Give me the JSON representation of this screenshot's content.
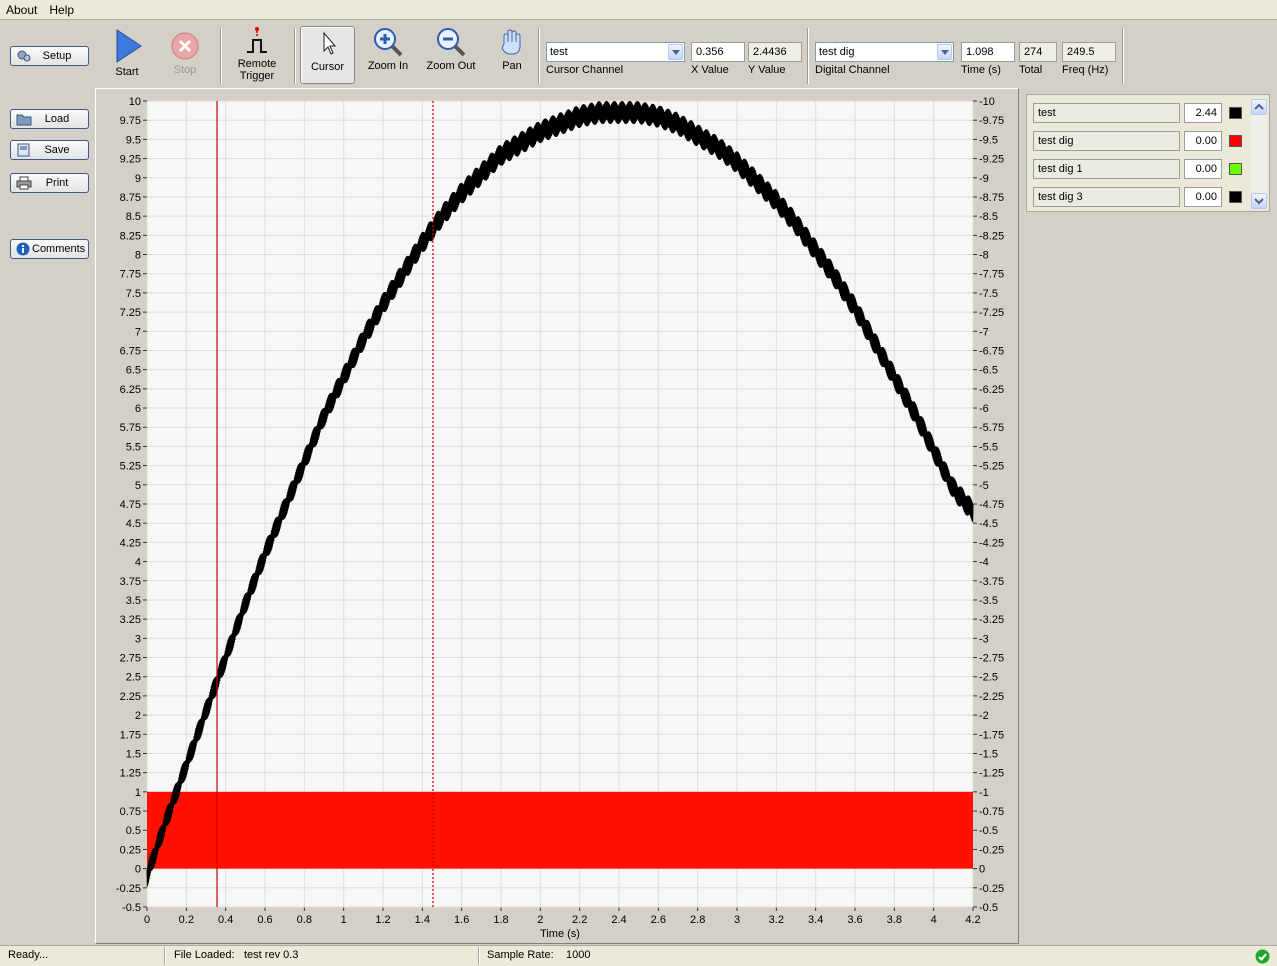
{
  "menu": [
    "About",
    "Help"
  ],
  "left_buttons": {
    "setup": "Setup",
    "load": "Load",
    "save": "Save",
    "print": "Print",
    "comments": "Comments"
  },
  "toolbar": {
    "start": "Start",
    "stop": "Stop",
    "remote_trigger_l1": "Remote",
    "remote_trigger_l2": "Trigger",
    "cursor": "Cursor",
    "zoom_in": "Zoom In",
    "zoom_out": "Zoom Out",
    "pan": "Pan",
    "cursor_channel": {
      "value": "test",
      "label": "Cursor Channel"
    },
    "x_value": {
      "value": "0.356",
      "label": "X Value"
    },
    "y_value": {
      "value": "2.4436",
      "label": "Y Value"
    },
    "digital_channel": {
      "value": "test dig",
      "label": "Digital Channel"
    },
    "time": {
      "value": "1.098",
      "label": "Time (s)"
    },
    "total": {
      "value": "274",
      "label": "Total"
    },
    "freq": {
      "value": "249.5",
      "label": "Freq (Hz)"
    }
  },
  "legend": [
    {
      "name": "test",
      "value": "2.44",
      "color": "#000000"
    },
    {
      "name": "test dig",
      "value": "0.00",
      "color": "#ff0000"
    },
    {
      "name": "test dig 1",
      "value": "0.00",
      "color": "#66ff00"
    },
    {
      "name": "test dig 3",
      "value": "0.00",
      "color": "#000000"
    }
  ],
  "chart_data": {
    "type": "line",
    "xlabel": "Time (s)",
    "ylabel": "",
    "xlim": [
      0,
      4.2
    ],
    "ylim": [
      -0.5,
      10
    ],
    "x_ticks": [
      "0",
      "0.2",
      "0.4",
      "0.6",
      "0.8",
      "1",
      "1.2",
      "1.4",
      "1.6",
      "1.8",
      "2",
      "2.2",
      "2.4",
      "2.6",
      "2.8",
      "3",
      "3.2",
      "3.4",
      "3.6",
      "3.8",
      "4",
      "4.2"
    ],
    "y_ticks": [
      "-0.5",
      "-0.25",
      "0",
      "0.25",
      "0.5",
      "0.75",
      "1",
      "1.25",
      "1.5",
      "1.75",
      "2",
      "2.25",
      "2.5",
      "2.75",
      "3",
      "3.25",
      "3.5",
      "3.75",
      "4",
      "4.25",
      "4.5",
      "4.75",
      "5",
      "5.25",
      "5.5",
      "5.75",
      "6",
      "6.25",
      "6.5",
      "6.75",
      "7",
      "7.25",
      "7.5",
      "7.75",
      "8",
      "8.25",
      "8.5",
      "8.75",
      "9",
      "9.25",
      "9.5",
      "9.75",
      "10"
    ],
    "y_ticks_right": [
      "-0.5",
      "-0.25",
      "0",
      "-0.25",
      "-0.5",
      "-0.75",
      "-1",
      "-1.25",
      "-1.5",
      "-1.75",
      "-2",
      "-2.25",
      "-2.5",
      "-2.75",
      "-3",
      "-3.25",
      "-3.5",
      "-3.75",
      "-4",
      "-4.25",
      "-4.5",
      "-4.75",
      "-5",
      "-5.25",
      "-5.5",
      "-5.75",
      "-6",
      "-6.25",
      "-6.5",
      "-6.75",
      "-7",
      "-7.25",
      "-7.5",
      "-7.75",
      "-8",
      "-8.25",
      "-8.5",
      "-8.75",
      "-9",
      "-9.25",
      "-9.5",
      "-9.75",
      "-10"
    ],
    "grid": true,
    "series": [
      {
        "name": "test",
        "color": "#000000",
        "x": [
          0,
          0.1,
          0.2,
          0.3,
          0.4,
          0.5,
          0.6,
          0.7,
          0.8,
          0.9,
          1.0,
          1.1,
          1.2,
          1.3,
          1.4,
          1.5,
          1.6,
          1.7,
          1.8,
          1.9,
          2.0,
          2.1,
          2.2,
          2.3,
          2.4,
          2.5,
          2.6,
          2.7,
          2.8,
          2.9,
          3.0,
          3.1,
          3.2,
          3.3,
          3.4,
          3.5,
          3.6,
          3.7,
          3.8,
          3.9,
          4.0,
          4.1,
          4.2
        ],
        "y": [
          -0.1,
          0.65,
          1.35,
          2.05,
          2.75,
          3.45,
          4.1,
          4.7,
          5.3,
          5.9,
          6.4,
          6.9,
          7.35,
          7.75,
          8.15,
          8.5,
          8.8,
          9.05,
          9.3,
          9.45,
          9.6,
          9.7,
          9.8,
          9.85,
          9.85,
          9.85,
          9.8,
          9.7,
          9.55,
          9.4,
          9.2,
          8.95,
          8.7,
          8.4,
          8.05,
          7.7,
          7.3,
          6.85,
          6.4,
          5.95,
          5.45,
          4.95,
          4.65
        ],
        "noise_amplitude": 0.15
      }
    ],
    "digital_band": {
      "name": "test dig",
      "color": "#ff1000",
      "y_low": 0,
      "y_high": 1,
      "x_start": 0,
      "x_end": 4.2
    },
    "cursors": [
      {
        "x": 0.356,
        "style": "solid",
        "color": "#cc0000"
      },
      {
        "x": 1.454,
        "style": "dotted",
        "color": "#cc0000"
      }
    ]
  },
  "status": {
    "ready": "Ready...",
    "file_label": "File Loaded:",
    "file_value": "test rev 0.3",
    "rate_label": "Sample Rate:",
    "rate_value": "1000"
  }
}
